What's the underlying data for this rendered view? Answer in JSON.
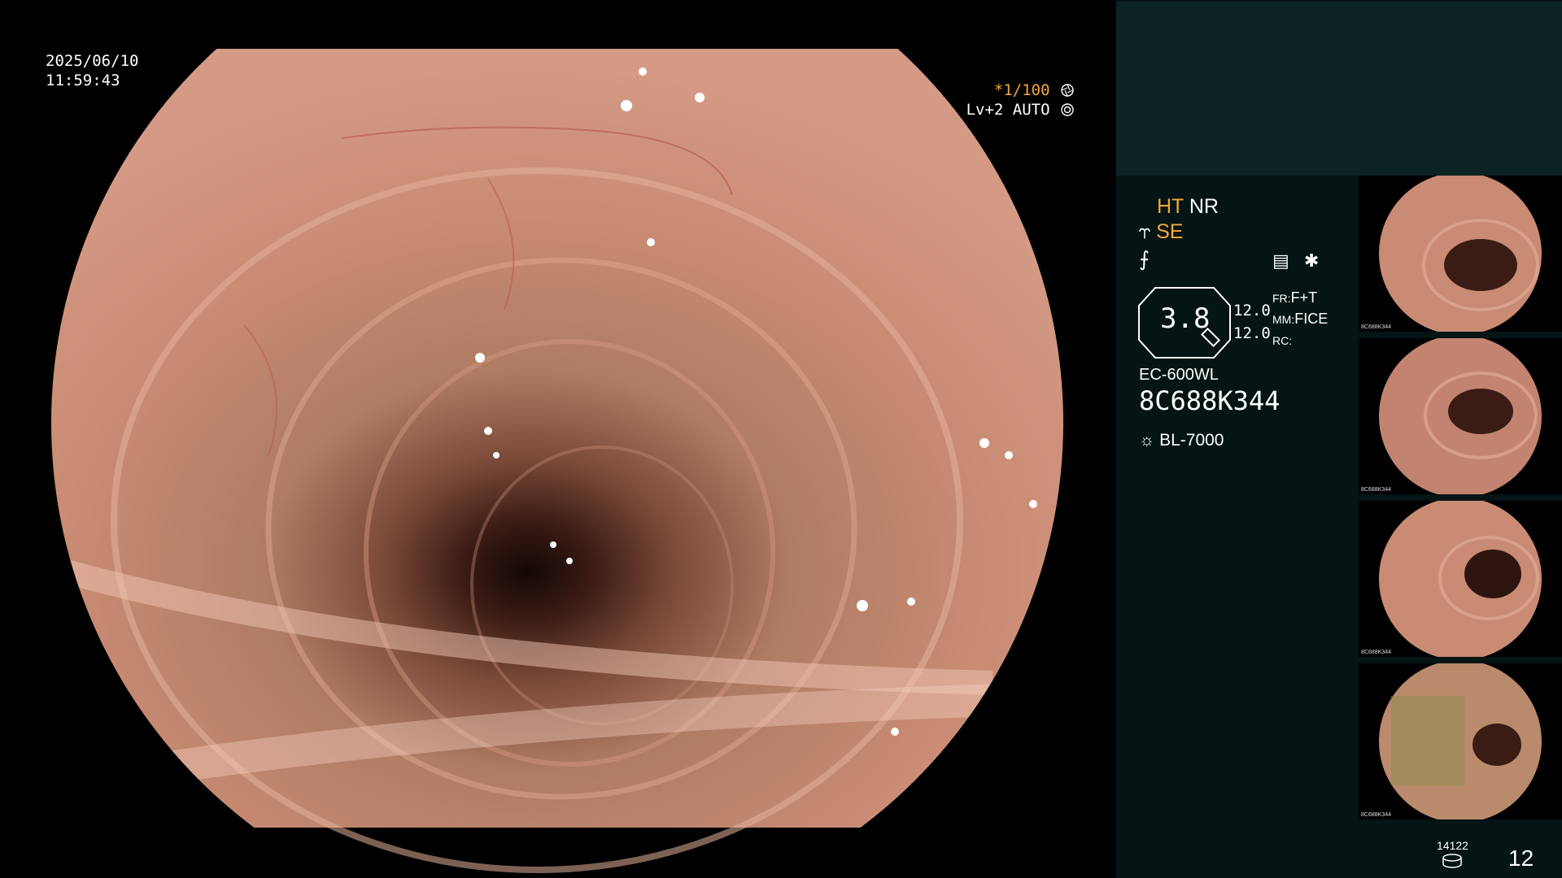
{
  "osd": {
    "date": "2025/06/10",
    "time": "11:59:43",
    "shutter_value": "*1/100",
    "iris_label": "Lv+2 AUTO"
  },
  "settings": {
    "ht": "HT",
    "nr": "NR",
    "se": "SE",
    "zoom": "3.8",
    "values": [
      "12.0",
      "12.0"
    ],
    "modes": [
      {
        "key": "FR:",
        "value": "F+T"
      },
      {
        "key": "MM:",
        "value": "FICE"
      },
      {
        "key": "RC:",
        "value": ""
      }
    ],
    "scope_model": "EC-600WL",
    "serial": "8C688K344",
    "light_source": "BL-7000"
  },
  "thumbnails": [
    {
      "label": "8C688K344"
    },
    {
      "label": "8C688K344"
    },
    {
      "label": "8C688K344"
    },
    {
      "label": "8C688K344"
    }
  ],
  "footer": {
    "disk_count": "14122",
    "page_number": "12"
  },
  "colors": {
    "accent": "#f2a93b",
    "panel_bg": "#051414",
    "panel_top": "#0b2323",
    "mucosa": "#c98b73"
  },
  "icons": [
    "aperture-icon",
    "iris-icon",
    "sun-icon",
    "disk-icon",
    "memo-icon",
    "asterisk-icon"
  ]
}
